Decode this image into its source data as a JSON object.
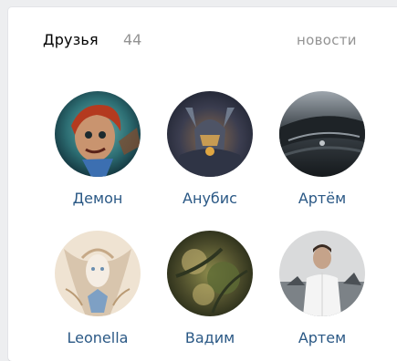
{
  "widget": {
    "title": "Друзья",
    "count": "44",
    "news_link": "новости"
  },
  "friends": [
    {
      "name": "Демон",
      "avatar_icon": "doll-portrait-avatar"
    },
    {
      "name": "Анубис",
      "avatar_icon": "warrior-portrait-avatar"
    },
    {
      "name": "Артём",
      "avatar_icon": "car-hood-avatar"
    },
    {
      "name": "Leonella",
      "avatar_icon": "elf-portrait-avatar"
    },
    {
      "name": "Вадим",
      "avatar_icon": "forest-abstract-avatar"
    },
    {
      "name": "Артем",
      "avatar_icon": "person-photo-avatar"
    }
  ],
  "colors": {
    "link": "#2a5885",
    "muted": "#939393",
    "background": "#edeef0",
    "card": "#ffffff"
  }
}
